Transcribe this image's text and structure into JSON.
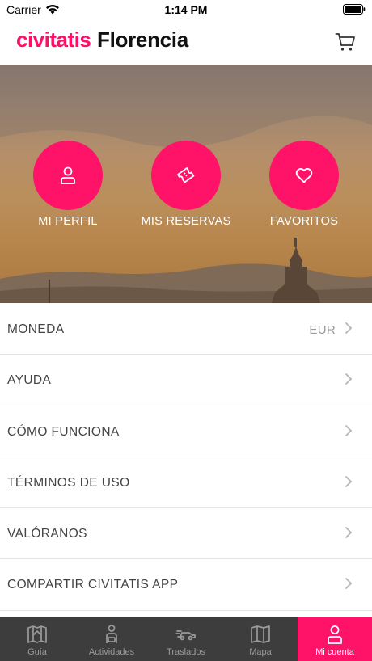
{
  "status_bar": {
    "carrier": "Carrier",
    "time": "1:14 PM"
  },
  "header": {
    "brand": "civitatis",
    "city": "Florencia"
  },
  "hero": {
    "buttons": [
      {
        "label": "MI PERFIL",
        "icon": "person-icon"
      },
      {
        "label": "MIS RESERVAS",
        "icon": "ticket-icon"
      },
      {
        "label": "FAVORITOS",
        "icon": "heart-icon"
      }
    ]
  },
  "menu": {
    "items": [
      {
        "label": "MONEDA",
        "value": "EUR"
      },
      {
        "label": "AYUDA"
      },
      {
        "label": "CÓMO FUNCIONA"
      },
      {
        "label": "TÉRMINOS DE USO"
      },
      {
        "label": "VALÓRANOS"
      },
      {
        "label": "COMPARTIR CIVITATIS APP"
      }
    ]
  },
  "tabbar": {
    "tabs": [
      {
        "label": "Guía",
        "icon": "guide-icon"
      },
      {
        "label": "Actividades",
        "icon": "activities-icon"
      },
      {
        "label": "Traslados",
        "icon": "transfer-icon"
      },
      {
        "label": "Mapa",
        "icon": "map-icon"
      },
      {
        "label": "Mi cuenta",
        "icon": "account-icon",
        "active": true
      }
    ]
  },
  "colors": {
    "brand": "#ff0f68",
    "accent": "#ff1369",
    "tabbar": "#3d3d3d"
  }
}
